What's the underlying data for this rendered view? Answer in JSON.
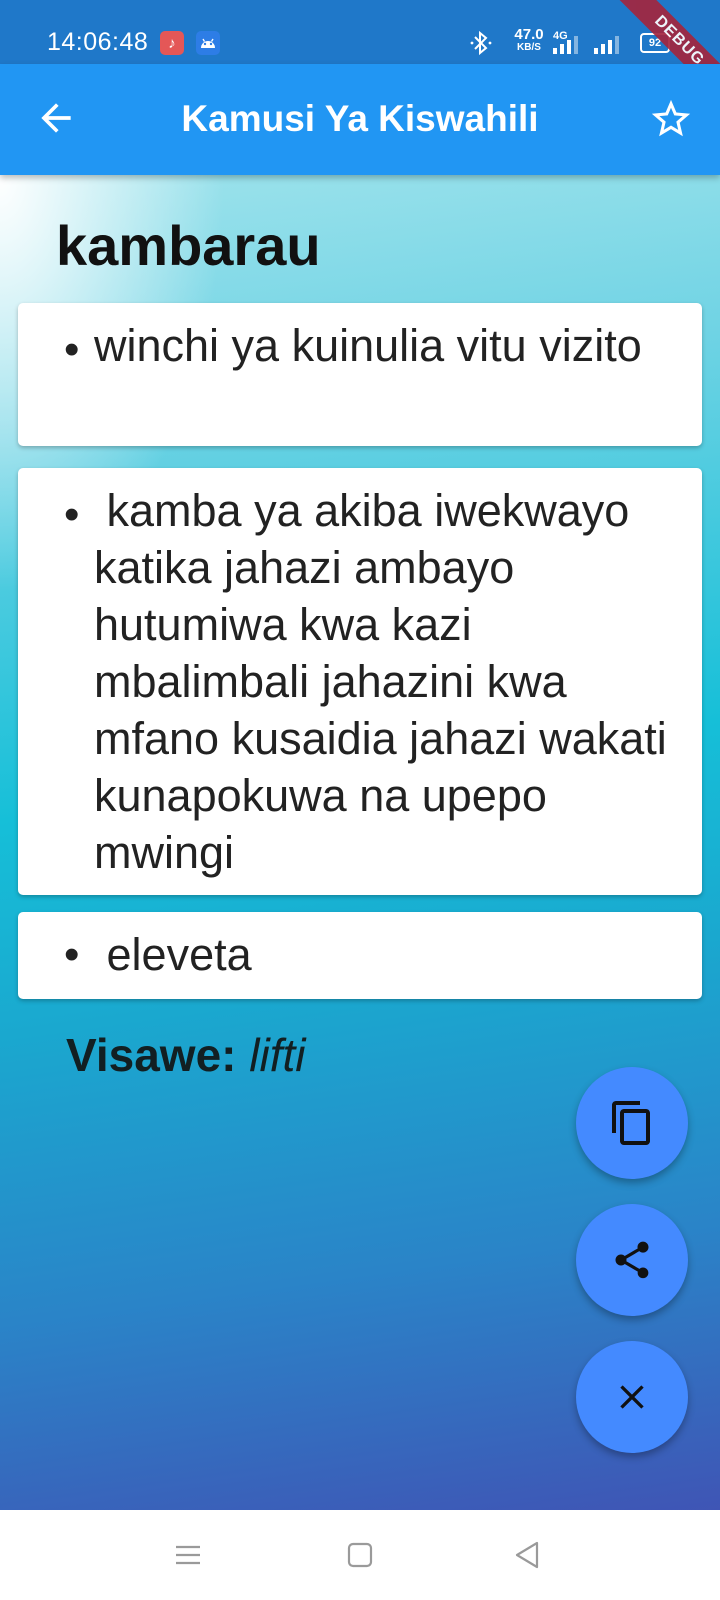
{
  "status_bar": {
    "time": "14:06:48",
    "net_speed_value": "47.0",
    "net_speed_unit": "KB/S",
    "network_type": "4G",
    "battery_level": "92",
    "debug_banner": "DEBUG",
    "icons": [
      "music-app-icon",
      "android-debug-icon",
      "bluetooth-icon",
      "signal-icon",
      "signal-icon",
      "battery-icon"
    ]
  },
  "app_bar": {
    "title": "Kamusi Ya Kiswahili",
    "back_icon": "arrow-back-icon",
    "favorite_icon": "star-outline-icon",
    "color": "#2196f3"
  },
  "entry": {
    "headword": "kambarau",
    "bullet": "•",
    "definitions": [
      {
        "text": "winchi ya kuinulia vitu vizito"
      },
      {
        "text": " kamba ya akiba iwekwayo katika jahazi ambayo hutumiwa kwa kazi mbalimbali jahazini kwa mfano kusaidia jahazi wakati kunapokuwa na upepo mwingi"
      },
      {
        "text": " eleveta"
      }
    ],
    "synonyms_label": "Visawe:",
    "synonyms_value": "lifti"
  },
  "fabs": [
    {
      "action": "copy",
      "icon": "copy-icon"
    },
    {
      "action": "share",
      "icon": "share-icon"
    },
    {
      "action": "close",
      "icon": "close-icon"
    }
  ],
  "fab_color": "#448aff",
  "nav_bar": {
    "buttons": [
      "menu-icon",
      "home-square-icon",
      "back-triangle-icon"
    ]
  }
}
